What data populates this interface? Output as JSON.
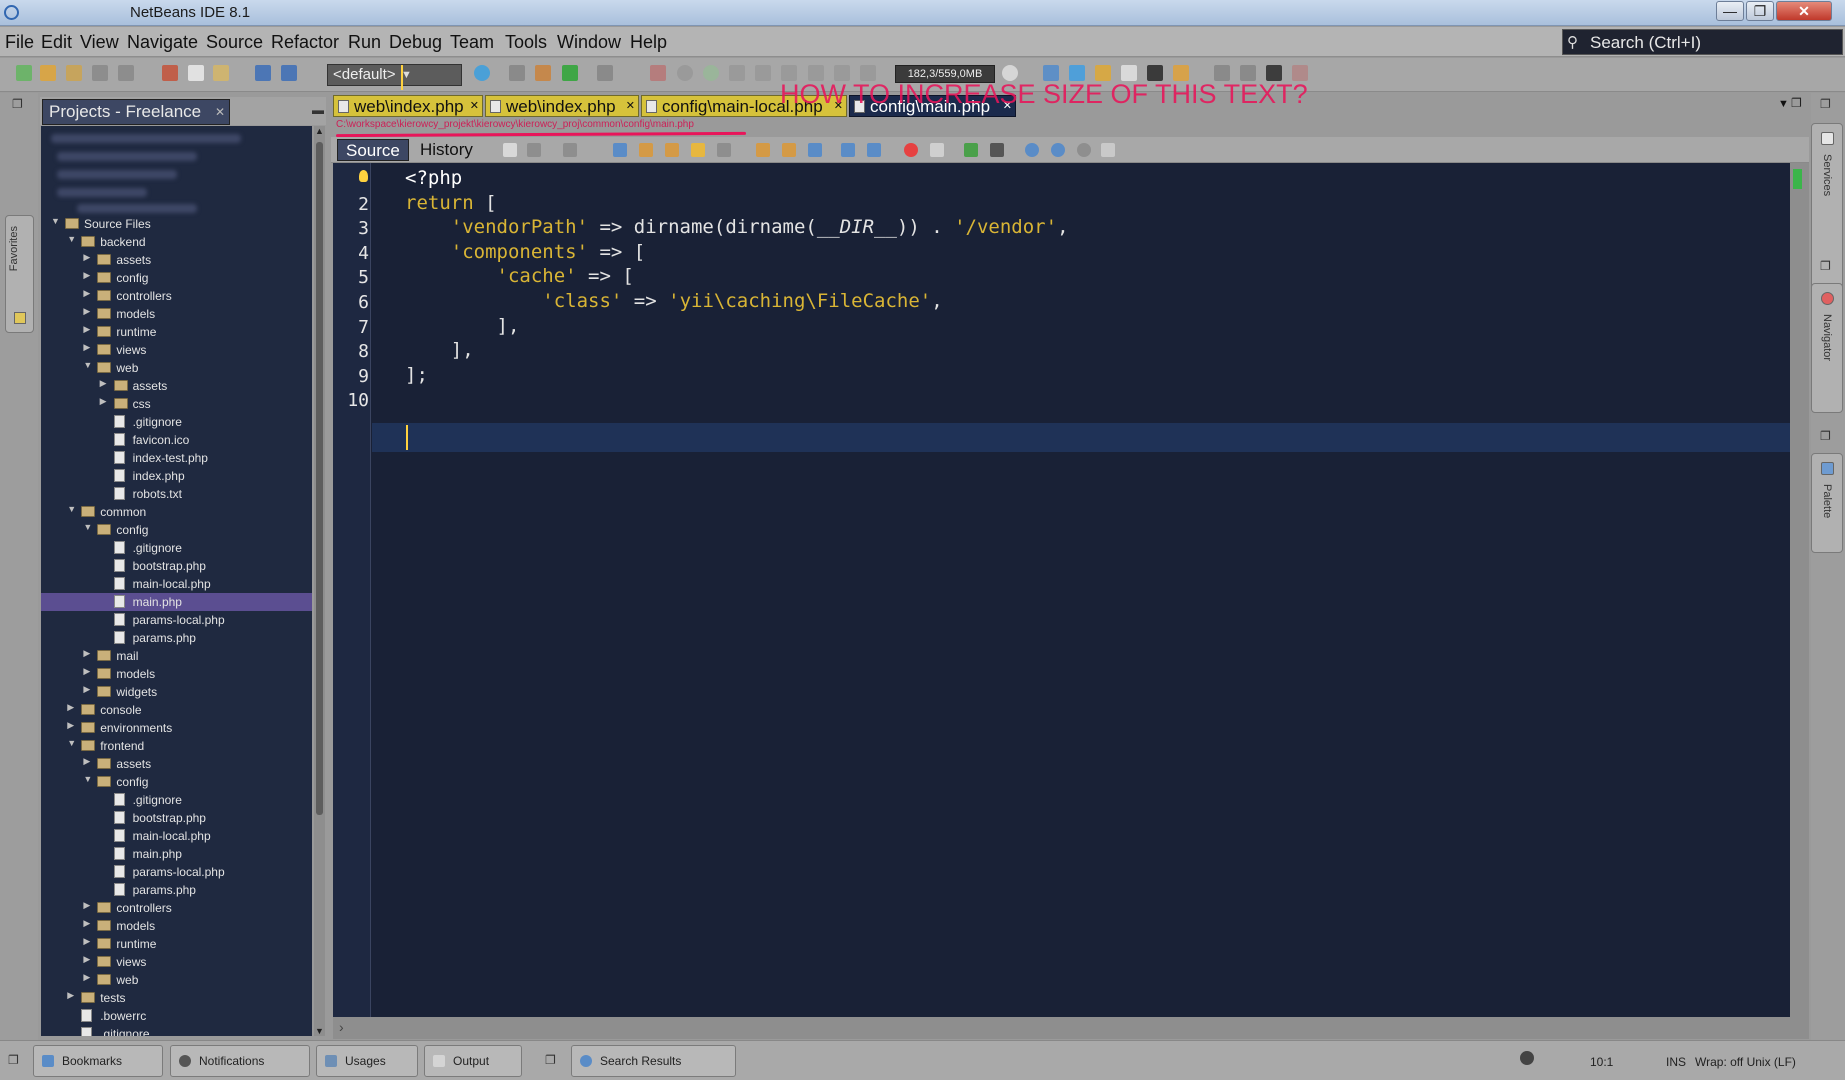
{
  "window": {
    "title": "NetBeans IDE 8.1",
    "minimize": "—",
    "maximize": "❐",
    "close": "✕"
  },
  "menubar": {
    "items": [
      "File",
      "Edit",
      "View",
      "Navigate",
      "Source",
      "Refactor",
      "Run",
      "Debug",
      "Team",
      "Tools",
      "Window",
      "Help"
    ]
  },
  "search": {
    "label": "Search (Ctrl+I)"
  },
  "toolbar": {
    "config": "<default>",
    "memory": "182,3/559,0MB"
  },
  "favorites": {
    "label": "Favorites"
  },
  "projects": {
    "tab_label": "Projects - Freelance",
    "tree": [
      {
        "name": "Source Files",
        "level": 1,
        "type": "folder",
        "expanded": true
      },
      {
        "name": "backend",
        "level": 2,
        "type": "folder",
        "expanded": true
      },
      {
        "name": "assets",
        "level": 3,
        "type": "folder",
        "expanded": false
      },
      {
        "name": "config",
        "level": 3,
        "type": "folder",
        "expanded": false
      },
      {
        "name": "controllers",
        "level": 3,
        "type": "folder",
        "expanded": false
      },
      {
        "name": "models",
        "level": 3,
        "type": "folder",
        "expanded": false
      },
      {
        "name": "runtime",
        "level": 3,
        "type": "folder",
        "expanded": false
      },
      {
        "name": "views",
        "level": 3,
        "type": "folder",
        "expanded": false
      },
      {
        "name": "web",
        "level": 3,
        "type": "folder",
        "expanded": true
      },
      {
        "name": "assets",
        "level": 4,
        "type": "folder",
        "expanded": false
      },
      {
        "name": "css",
        "level": 4,
        "type": "folder",
        "expanded": false
      },
      {
        "name": ".gitignore",
        "level": 4,
        "type": "file"
      },
      {
        "name": "favicon.ico",
        "level": 4,
        "type": "file"
      },
      {
        "name": "index-test.php",
        "level": 4,
        "type": "file"
      },
      {
        "name": "index.php",
        "level": 4,
        "type": "file"
      },
      {
        "name": "robots.txt",
        "level": 4,
        "type": "file"
      },
      {
        "name": "common",
        "level": 2,
        "type": "folder",
        "expanded": true
      },
      {
        "name": "config",
        "level": 3,
        "type": "folder",
        "expanded": true
      },
      {
        "name": ".gitignore",
        "level": 4,
        "type": "file"
      },
      {
        "name": "bootstrap.php",
        "level": 4,
        "type": "file"
      },
      {
        "name": "main-local.php",
        "level": 4,
        "type": "file"
      },
      {
        "name": "main.php",
        "level": 4,
        "type": "file",
        "selected": true
      },
      {
        "name": "params-local.php",
        "level": 4,
        "type": "file"
      },
      {
        "name": "params.php",
        "level": 4,
        "type": "file"
      },
      {
        "name": "mail",
        "level": 3,
        "type": "folder",
        "expanded": false
      },
      {
        "name": "models",
        "level": 3,
        "type": "folder",
        "expanded": false
      },
      {
        "name": "widgets",
        "level": 3,
        "type": "folder",
        "expanded": false
      },
      {
        "name": "console",
        "level": 2,
        "type": "folder",
        "expanded": false
      },
      {
        "name": "environments",
        "level": 2,
        "type": "folder",
        "expanded": false
      },
      {
        "name": "frontend",
        "level": 2,
        "type": "folder",
        "expanded": true
      },
      {
        "name": "assets",
        "level": 3,
        "type": "folder",
        "expanded": false
      },
      {
        "name": "config",
        "level": 3,
        "type": "folder",
        "expanded": true
      },
      {
        "name": ".gitignore",
        "level": 4,
        "type": "file"
      },
      {
        "name": "bootstrap.php",
        "level": 4,
        "type": "file"
      },
      {
        "name": "main-local.php",
        "level": 4,
        "type": "file"
      },
      {
        "name": "main.php",
        "level": 4,
        "type": "file"
      },
      {
        "name": "params-local.php",
        "level": 4,
        "type": "file"
      },
      {
        "name": "params.php",
        "level": 4,
        "type": "file"
      },
      {
        "name": "controllers",
        "level": 3,
        "type": "folder",
        "expanded": false
      },
      {
        "name": "models",
        "level": 3,
        "type": "folder",
        "expanded": false
      },
      {
        "name": "runtime",
        "level": 3,
        "type": "folder",
        "expanded": false
      },
      {
        "name": "views",
        "level": 3,
        "type": "folder",
        "expanded": false
      },
      {
        "name": "web",
        "level": 3,
        "type": "folder",
        "expanded": false
      },
      {
        "name": "tests",
        "level": 2,
        "type": "folder",
        "expanded": false
      },
      {
        "name": ".bowerrc",
        "level": 2,
        "type": "file"
      },
      {
        "name": ".gitignore",
        "level": 2,
        "type": "file"
      }
    ]
  },
  "editor": {
    "tabs": [
      {
        "label": "web\\index.php",
        "active": false
      },
      {
        "label": "web\\index.php",
        "active": false
      },
      {
        "label": "config\\main-local.php",
        "active": false
      },
      {
        "label": "config\\main.php",
        "active": true
      }
    ],
    "annotation": "HOW TO INCREASE SIZE OF THIS TEXT?",
    "file_path": "C:\\workspace\\kierowcy_projekt\\kierowcy\\kierowcy_proj\\common\\config\\main.php",
    "source_label": "Source",
    "history_label": "History",
    "lines": [
      [
        {
          "t": "<?php",
          "c": "tag"
        }
      ],
      [
        {
          "t": "return",
          "c": "kw"
        },
        {
          "t": " [",
          "c": ""
        }
      ],
      [
        {
          "t": "    ",
          "c": ""
        },
        {
          "t": "'vendorPath'",
          "c": "str"
        },
        {
          "t": " => dirname(dirname(",
          "c": ""
        },
        {
          "t": "__DIR__",
          "c": "const"
        },
        {
          "t": ")) . ",
          "c": ""
        },
        {
          "t": "'/vendor'",
          "c": "str"
        },
        {
          "t": ",",
          "c": ""
        }
      ],
      [
        {
          "t": "    ",
          "c": ""
        },
        {
          "t": "'components'",
          "c": "str"
        },
        {
          "t": " => [",
          "c": ""
        }
      ],
      [
        {
          "t": "        ",
          "c": ""
        },
        {
          "t": "'cache'",
          "c": "str"
        },
        {
          "t": " => [",
          "c": ""
        }
      ],
      [
        {
          "t": "            ",
          "c": ""
        },
        {
          "t": "'class'",
          "c": "str"
        },
        {
          "t": " => ",
          "c": ""
        },
        {
          "t": "'yii\\caching\\FileCache'",
          "c": "str"
        },
        {
          "t": ",",
          "c": ""
        }
      ],
      [
        {
          "t": "        ],",
          "c": ""
        }
      ],
      [
        {
          "t": "    ],",
          "c": ""
        }
      ],
      [
        {
          "t": "];",
          "c": ""
        }
      ],
      [
        {
          "t": "",
          "c": ""
        }
      ]
    ]
  },
  "right_panels": {
    "services": "Services",
    "navigator": "Navigator",
    "palette": "Palette"
  },
  "statusbar": {
    "buttons": [
      "Bookmarks",
      "Notifications",
      "Usages",
      "Output",
      "Search Results"
    ],
    "position": "10:1",
    "insert_mode": "INS",
    "wrap": "Wrap: off Unix (LF)"
  }
}
